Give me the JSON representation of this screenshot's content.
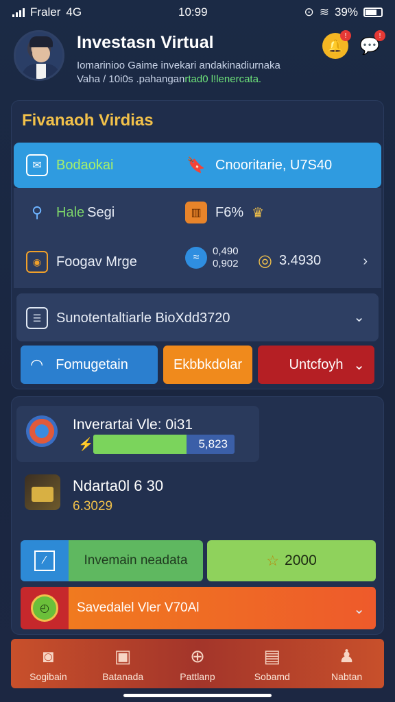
{
  "status": {
    "carrier": "Fraler",
    "network": "4G",
    "time": "10:99",
    "battery": "39%"
  },
  "header": {
    "title": "Investasn Virtual",
    "subtitle_line1": "Iomarinioo Gaime invekari andakinadiurnaka",
    "subtitle_line2_plain": "Vaha / 10i0s .pahangan",
    "subtitle_line2_highlight": "rtad0 l!lenercata."
  },
  "panel1": {
    "section_title": "Fivanaoh Virdias",
    "row1": {
      "left_label": "Bodaokai",
      "right_label": "Cnooritarie, U7S40"
    },
    "row2": {
      "left_label_green": "Hale",
      "left_label": "Segi",
      "right_label": "F6%"
    },
    "row3": {
      "left_label": "Foogav Mrge",
      "mid_value_top": "0,490",
      "mid_value_bottom": "0,902",
      "right_value": "3.4930"
    },
    "row4": {
      "label": "Sunotentaltiarle BioXdd3720"
    },
    "buttons": {
      "blue": "Fomugetain",
      "orange": "Ekbbkdolar",
      "red": "Untcfoyh"
    }
  },
  "panel2": {
    "investment": {
      "title": "Inverartai Vle: 0i31",
      "progress_value": "5,823",
      "progress_percent": 66
    },
    "item": {
      "title": "Ndarta0l 6 30",
      "subtitle": "6.3029"
    },
    "green_row": {
      "left_label": "Invemain neadata",
      "right_label": "2000"
    },
    "orange_row": {
      "label": "Savedalel Vler V70Al"
    }
  },
  "tabbar": {
    "tabs": [
      "Sogibain",
      "Batanada",
      "Pattlanp",
      "Sobamd",
      "Nabtan"
    ]
  },
  "colors": {
    "accent_blue": "#2f9be0",
    "gold": "#f2c14a",
    "green": "#7bd45c",
    "orange": "#f08a1c",
    "red": "#b51f24"
  }
}
